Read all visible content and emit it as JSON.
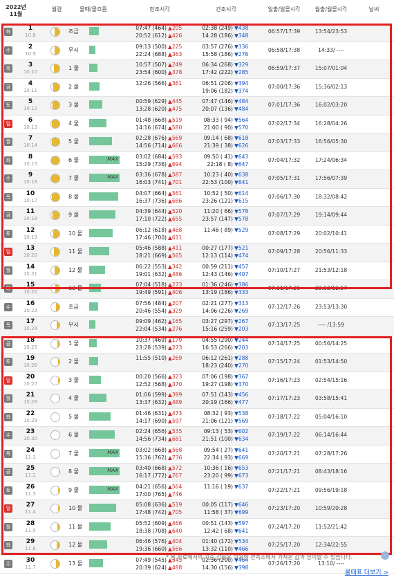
{
  "header": {
    "year_month": "2022년 11월",
    "moon_phase": "월령",
    "tide": "물때/물흐름",
    "high_tide": "만조시각",
    "low_tide": "간조시각",
    "sunrise_sunset": "일출/일몰시각",
    "moonrise_moonset": "월출/월몰시각",
    "weather": "날씨"
  },
  "colors": {
    "box": "#e02020",
    "bar": "#75c69a",
    "moon": "#e6b830",
    "up": "#d12b2b",
    "down": "#1a56c4"
  },
  "rows": [
    {
      "day": "1",
      "lunar": "10.8",
      "dow": "화",
      "tide": "조금",
      "moon_lit": 0.55,
      "bar": 0.22,
      "max": "",
      "h1": "07:47 (464)",
      "h1d": "▲205",
      "h2": "20:52 (612)",
      "h2d": "▲426",
      "l1": "02:38 (249)",
      "l1d": "▼438",
      "l2": "14:28 (186)",
      "l2d": "▼348",
      "sun": "06:57/17:39",
      "moon": "13:54/23:53"
    },
    {
      "day": "2",
      "lunar": "10.9",
      "dow": "수",
      "tide": "무시",
      "moon_lit": 0.62,
      "bar": 0.12,
      "max": "",
      "h1": "09:13 (500)",
      "h1d": "▲225",
      "h2": "22:24 (688)",
      "h2d": "▲363",
      "l1": "03:57 (276)",
      "l1d": "▼336",
      "l2": "15:58 (186)",
      "l2d": "▼276",
      "sun": "06:58/17:38",
      "moon": "14:33/ ----"
    },
    {
      "day": "3",
      "lunar": "10.10",
      "dow": "목",
      "tide": "1 물",
      "moon_lit": 0.7,
      "bar": 0.18,
      "max": "",
      "h1": "10:57 (507)",
      "h1d": "▲249",
      "h2": "23:54 (600)",
      "h2d": "▲378",
      "l1": "06:34 (268)",
      "l1d": "▼329",
      "l2": "17:42 (222)",
      "l2d": "▼285",
      "sun": "06:59/17:37",
      "moon": "15:07/01:04"
    },
    {
      "day": "4",
      "lunar": "10.11",
      "dow": "금",
      "tide": "2 물",
      "moon_lit": 0.78,
      "bar": 0.26,
      "max": "",
      "h1": "12:26 (566)",
      "h1d": "▲361",
      "h2": "",
      "h2d": "",
      "l1": "06:51 (206)",
      "l1d": "▼394",
      "l2": "19:06 (182)",
      "l2d": "▼374",
      "sun": "07:00/17:36",
      "moon": "15:36/02:13"
    },
    {
      "day": "5",
      "lunar": "10.12",
      "dow": "토",
      "tide": "3 물",
      "moon_lit": 0.85,
      "bar": 0.34,
      "max": "",
      "h1": "00:59 (629)",
      "h1d": "▲445",
      "h2": "13:28 (620)",
      "h2d": "▲475",
      "l1": "07:47 (146)",
      "l1d": "▼484",
      "l2": "20:07 (136)",
      "l2d": "▼484",
      "sun": "07:01/17:36",
      "moon": "16:02/03:20"
    },
    {
      "day": "6",
      "lunar": "10.13",
      "dow": "일",
      "tide": "4 물",
      "moon_lit": 0.9,
      "bar": 0.48,
      "max": "",
      "h1": "01:48 (668)",
      "h1d": "▲519",
      "h2": "14:16 (674)",
      "h2d": "▲580",
      "l1": "08:33 ( 94)",
      "l1d": "▼564",
      "l2": "21:00 ( 90)",
      "l2d": "▼570",
      "sun": "07:02/17:34",
      "moon": "16:28/04:26"
    },
    {
      "day": "7",
      "lunar": "10.14",
      "dow": "월",
      "tide": "5 물",
      "moon_lit": 0.95,
      "bar": 0.66,
      "max": "",
      "h1": "02:28 (676)",
      "h1d": "▲569",
      "h2": "14:56 (714)",
      "h2d": "▲666",
      "l1": "09:14 ( 68)",
      "l1d": "▼618",
      "l2": "21:39 ( 38)",
      "l2d": "▼626",
      "sun": "07:03/17:33",
      "moon": "16:56/05:30"
    },
    {
      "day": "8",
      "lunar": "10.15",
      "dow": "화",
      "tide": "6 물",
      "moon_lit": 1.0,
      "bar": 0.92,
      "max": "MAX",
      "h1": "03:02 (684)",
      "h1d": "▲593",
      "h2": "15:29 (736)",
      "h2d": "▲694",
      "l1": "09:50 ( 41)",
      "l1d": "▼643",
      "l2": "22:18 ( 8)",
      "l2d": "▼647",
      "sun": "07:04/17:32",
      "moon": "17:24/06:34"
    },
    {
      "day": "9",
      "lunar": "10.16",
      "dow": "수",
      "tide": "7 물",
      "moon_lit": 0.97,
      "bar": 0.92,
      "max": "MAX",
      "h1": "03:36 (678)",
      "h1d": "▲587",
      "h2": "16:03 (741)",
      "h2d": "▲701",
      "l1": "10:23 ( 40)",
      "l1d": "▼638",
      "l2": "22:53 (100)",
      "l2d": "▼641",
      "sun": "07:05/17:31",
      "moon": "17:56/07:39"
    },
    {
      "day": "10",
      "lunar": "10.17",
      "dow": "목",
      "tide": "8 물",
      "moon_lit": 0.9,
      "bar": 0.86,
      "max": "",
      "h1": "04:07 (664)",
      "h1d": "▲561",
      "h2": "16:37 (736)",
      "h2d": "▲686",
      "l1": "10:52 ( 50)",
      "l1d": "▼614",
      "l2": "23:26 (121)",
      "l2d": "▼615",
      "sun": "07:06/17:30",
      "moon": "18:32/08:42"
    },
    {
      "day": "11",
      "lunar": "10.18",
      "dow": "금",
      "tide": "9 물",
      "moon_lit": 0.82,
      "bar": 0.78,
      "max": "",
      "h1": "04:39 (644)",
      "h1d": "▲520",
      "h2": "17:10 (722)",
      "h2d": "▲655",
      "l1": "11:20 ( 66)",
      "l1d": "▼578",
      "l2": "23:57 (147)",
      "l2d": "▼578",
      "sun": "07:07/17:29",
      "moon": "19:14/09:44"
    },
    {
      "day": "12",
      "lunar": "10.19",
      "dow": "토",
      "tide": "10 물",
      "moon_lit": 0.74,
      "bar": 0.68,
      "max": "",
      "h1": "06:12 (618)",
      "h1d": "▲468",
      "h2": "17:46 (700)",
      "h2d": "▲611",
      "l1": "11:46 ( 89)",
      "l1d": "▼529",
      "l2": "",
      "l2d": "",
      "sun": "07:08/17:29",
      "moon": "20:02/10:41"
    },
    {
      "day": "13",
      "lunar": "10.20",
      "dow": "일",
      "tide": "11 물",
      "moon_lit": 0.66,
      "bar": 0.56,
      "max": "",
      "h1": "05:46 (588)",
      "h1d": "▲411",
      "h2": "18:21 (669)",
      "h2d": "▲565",
      "l1": "00:27 (177)",
      "l1d": "▼521",
      "l2": "12:13 (114)",
      "l2d": "▼474",
      "sun": "07:09/17:28",
      "moon": "20:56/11:33"
    },
    {
      "day": "14",
      "lunar": "10.21",
      "dow": "월",
      "tide": "12 물",
      "moon_lit": 0.58,
      "bar": 0.44,
      "max": "",
      "h1": "06:22 (553)",
      "h1d": "▲342",
      "h2": "19:01 (632)",
      "h2d": "▲486",
      "l1": "00:59 (211)",
      "l1d": "▼457",
      "l2": "12:43 (146)",
      "l2d": "▼407",
      "sun": "07:10/17:27",
      "moon": "21:53/12:18"
    },
    {
      "day": "15",
      "lunar": "10.22",
      "dow": "화",
      "tide": "13 물",
      "moon_lit": 0.5,
      "bar": 0.3,
      "max": "",
      "h1": "07:04 (518)",
      "h1d": "▲273",
      "h2": "19:49 (591)",
      "h2d": "▲406",
      "l1": "01:36 (246)",
      "l1d": "▼386",
      "l2": "13:19 (186)",
      "l2d": "▼333",
      "sun": "07:11/17:26",
      "moon": "22:52/12:57"
    },
    {
      "day": "16",
      "lunar": "10.23",
      "dow": "수",
      "tide": "조금",
      "moon_lit": 0.42,
      "bar": 0.2,
      "max": "",
      "h1": "07:56 (484)",
      "h1d": "▲207",
      "h2": "20:46 (554)",
      "h2d": "▲329",
      "l1": "02:21 (277)",
      "l1d": "▼313",
      "l2": "14:06 (226)",
      "l2d": "▼269",
      "sun": "07:12/17:26",
      "moon": "23:53/13:30"
    },
    {
      "day": "17",
      "lunar": "10.24",
      "dow": "목",
      "tide": "무시",
      "moon_lit": 0.34,
      "bar": 0.12,
      "max": "",
      "h1": "09:09 (462)",
      "h1d": "▲165",
      "h2": "22:04 (534)",
      "h2d": "▲276",
      "l1": "03:27 (297)",
      "l1d": "▼267",
      "l2": "15:16 (259)",
      "l2d": "▼203",
      "sun": "07:13/17:25",
      "moon": "---- /13:59"
    },
    {
      "day": "18",
      "lunar": "10.25",
      "dow": "금",
      "tide": "1 물",
      "moon_lit": 0.26,
      "bar": 0.16,
      "max": "",
      "h1": "10:37 (469)",
      "h1d": "▲179",
      "h2": "23:28 (539)",
      "h2d": "▲273",
      "l1": "04:55 (290)",
      "l1d": "▼244",
      "l2": "16:53 (266)",
      "l2d": "▼203",
      "sun": "07:14/17:25",
      "moon": "00:56/14:25"
    },
    {
      "day": "19",
      "lunar": "10.26",
      "dow": "토",
      "tide": "2 물",
      "moon_lit": 0.2,
      "bar": 0.2,
      "max": "",
      "h1": "11:55 (510)",
      "h1d": "▲269",
      "h2": "",
      "h2d": "",
      "l1": "06:12 (261)",
      "l1d": "▼288",
      "l2": "18:23 (240)",
      "l2d": "▼270",
      "sun": "07:15/17:24",
      "moon": "01:53/14:50"
    },
    {
      "day": "20",
      "lunar": "10.27",
      "dow": "일",
      "tide": "3 물",
      "moon_lit": 0.14,
      "bar": 0.3,
      "max": "",
      "h1": "00:20 (566)",
      "h1d": "▲323",
      "h2": "12:52 (568)",
      "h2d": "▲370",
      "l1": "07:06 (198)",
      "l1d": "▼367",
      "l2": "19:27 (198)",
      "l2d": "▼370",
      "sun": "07:16/17:23",
      "moon": "02:54/15:16"
    },
    {
      "day": "21",
      "lunar": "10.28",
      "dow": "월",
      "tide": "4 물",
      "moon_lit": 0.08,
      "bar": 0.48,
      "max": "",
      "h1": "01:06 (599)",
      "h1d": "▲399",
      "h2": "13:37 (632)",
      "h2d": "▲489",
      "l1": "07:51 (143)",
      "l1d": "▼456",
      "l2": "20:19 (166)",
      "l2d": "▼477",
      "sun": "07:17/17:23",
      "moon": "03:58/15:41"
    },
    {
      "day": "22",
      "lunar": "10.29",
      "dow": "화",
      "tide": "5 물",
      "moon_lit": 0.04,
      "bar": 0.62,
      "max": "",
      "h1": "01:46 (631)",
      "h1d": "▲473",
      "h2": "14:17 (690)",
      "h2d": "▲597",
      "l1": "08:32 ( 93)",
      "l1d": "▼538",
      "l2": "21:06 (121)",
      "l2d": "▼569",
      "sun": "07:18/17:22",
      "moon": "05:04/16:10"
    },
    {
      "day": "23",
      "lunar": "10.30",
      "dow": "수",
      "tide": "6 물",
      "moon_lit": 0.0,
      "bar": 0.76,
      "max": "",
      "h1": "02:24 (656)",
      "h1d": "▲535",
      "h2": "14:56 (734)",
      "h2d": "▲681",
      "l1": "09:13 ( 53)",
      "l1d": "▼602",
      "l2": "21:51 (100)",
      "l2d": "▼634",
      "sun": "07:19/17:22",
      "moon": "06:14/16:44"
    },
    {
      "day": "24",
      "lunar": "11.1",
      "dow": "목",
      "tide": "7 물",
      "moon_lit": 0.04,
      "bar": 0.92,
      "max": "MAX",
      "h1": "03:02 (668)",
      "h1d": "▲568",
      "h2": "15:36 (762)",
      "h2d": "▲736",
      "l1": "09:54 ( 27)",
      "l1d": "▼641",
      "l2": "22:34 ( 93)",
      "l2d": "▼669",
      "sun": "07:20/17:21",
      "moon": "07:28/17:26"
    },
    {
      "day": "25",
      "lunar": "11.2",
      "dow": "금",
      "tide": "8 물",
      "moon_lit": 0.08,
      "bar": 0.92,
      "max": "MAX",
      "h1": "03:40 (668)",
      "h1d": "▲572",
      "h2": "16:17 (772)",
      "h2d": "▲767",
      "l1": "10:36 ( 16)",
      "l1d": "▼653",
      "l2": "23:20 ( 99)",
      "l2d": "▼673",
      "sun": "07:21/17:21",
      "moon": "08:43/18:16"
    },
    {
      "day": "26",
      "lunar": "11.3",
      "dow": "토",
      "tide": "9 물",
      "moon_lit": 0.14,
      "bar": 0.92,
      "max": "MAX",
      "h1": "04:21 (656)",
      "h1d": "▲564",
      "h2": "17:00 (765)",
      "h2d": "▲746",
      "l1": "11:16 ( 19)",
      "l1d": "▼637",
      "l2": "",
      "l2d": "",
      "sun": "07:22/17:21",
      "moon": "09:56/19:18"
    },
    {
      "day": "27",
      "lunar": "11.4",
      "dow": "일",
      "tide": "10 물",
      "moon_lit": 0.2,
      "bar": 0.8,
      "max": "",
      "h1": "05:08 (636)",
      "h1d": "▲519",
      "h2": "17:48 (742)",
      "h2d": "▲705",
      "l1": "00:05 (117)",
      "l1d": "▼646",
      "l2": "11:58 ( 37)",
      "l2d": "▼699",
      "sun": "07:23/17:20",
      "moon": "10:59/20:28"
    },
    {
      "day": "28",
      "lunar": "11.5",
      "dow": "월",
      "tide": "11 물",
      "moon_lit": 0.28,
      "bar": 0.62,
      "max": "",
      "h1": "05:52 (609)",
      "h1d": "▲466",
      "h2": "18:38 (708)",
      "h2d": "▲640",
      "l1": "00:51 (143)",
      "l1d": "▼597",
      "l2": "12:42 ( 68)",
      "l2d": "▼641",
      "sun": "07:24/17:20",
      "moon": "11:52/21:42"
    },
    {
      "day": "29",
      "lunar": "11.6",
      "dow": "화",
      "tide": "12 물",
      "moon_lit": 0.36,
      "bar": 0.5,
      "max": "",
      "h1": "06:46 (576)",
      "h1d": "▲404",
      "h2": "19:36 (660)",
      "h2d": "▲566",
      "l1": "01:40 (172)",
      "l1d": "▼534",
      "l2": "13:32 (110)",
      "l2d": "▼466",
      "sun": "07:25/17:20",
      "moon": "12:34/22:55"
    },
    {
      "day": "30",
      "lunar": "11.7",
      "dow": "수",
      "tide": "13 물",
      "moon_lit": 0.44,
      "bar": 0.36,
      "max": "",
      "h1": "07:49 (545)",
      "h1d": "▲345",
      "h2": "20:39 (624)",
      "h2d": "▲488",
      "l1": "02:36 (200)",
      "l1d": "▼464",
      "l2": "14:30 (156)",
      "l2d": "▼398",
      "sun": "07:26/17:20",
      "moon": "13:10/ ----"
    }
  ],
  "footer": {
    "note": "* 본 자료에서의 기준 값들은 이용한 관측소에서 가져온 값과 상이할 수 있습니다.",
    "more_link": "물때표 더보기 >"
  }
}
